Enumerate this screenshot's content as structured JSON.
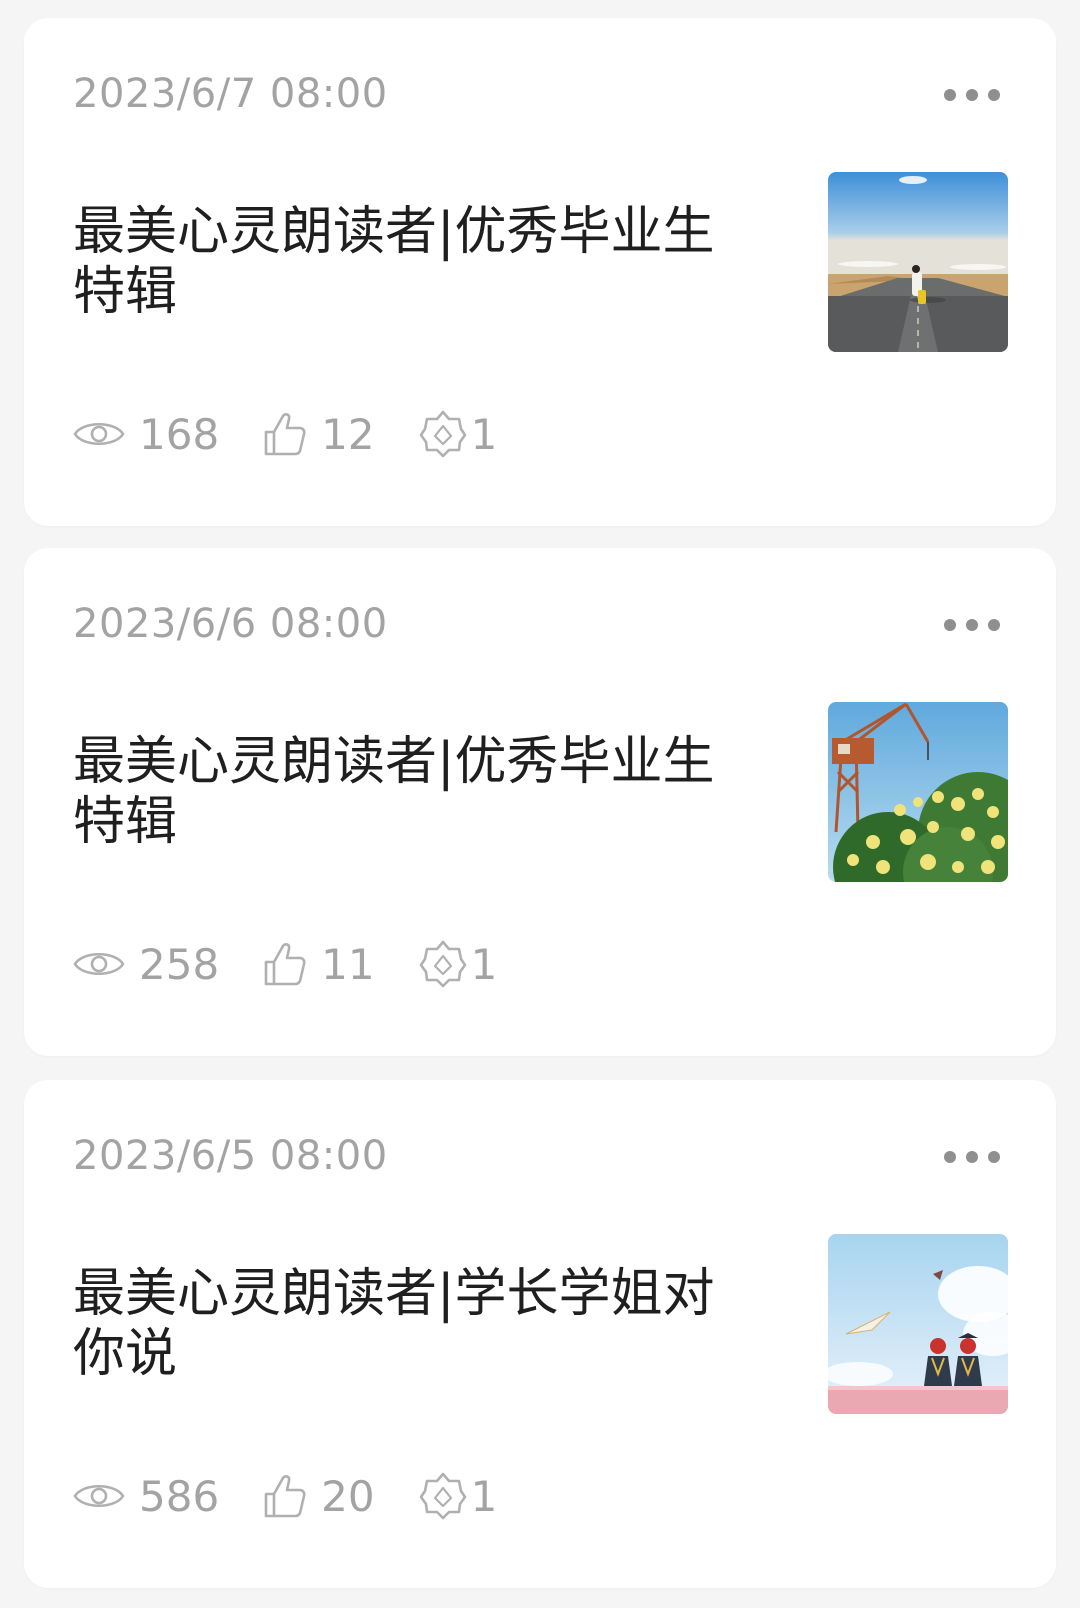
{
  "posts": [
    {
      "date": "2023/6/7 08:00",
      "title": "最美心灵朗读者|优秀毕业生特辑",
      "views": "168",
      "likes": "12",
      "shares": "1",
      "thumbnail": "girl-walking-on-desert-road"
    },
    {
      "date": "2023/6/6 08:00",
      "title": "最美心灵朗读者|优秀毕业生特辑",
      "views": "258",
      "likes": "11",
      "shares": "1",
      "thumbnail": "crane-and-yellow-roses"
    },
    {
      "date": "2023/6/5 08:00",
      "title": "最美心灵朗读者|学长学姐对你说",
      "views": "586",
      "likes": "20",
      "shares": "1",
      "thumbnail": "graduates-paper-plane-illustration"
    }
  ],
  "colors": {
    "background": "#f5f5f5",
    "card": "#ffffff",
    "meta_text": "#a3a3a3",
    "title_text": "#1f1f1f"
  }
}
